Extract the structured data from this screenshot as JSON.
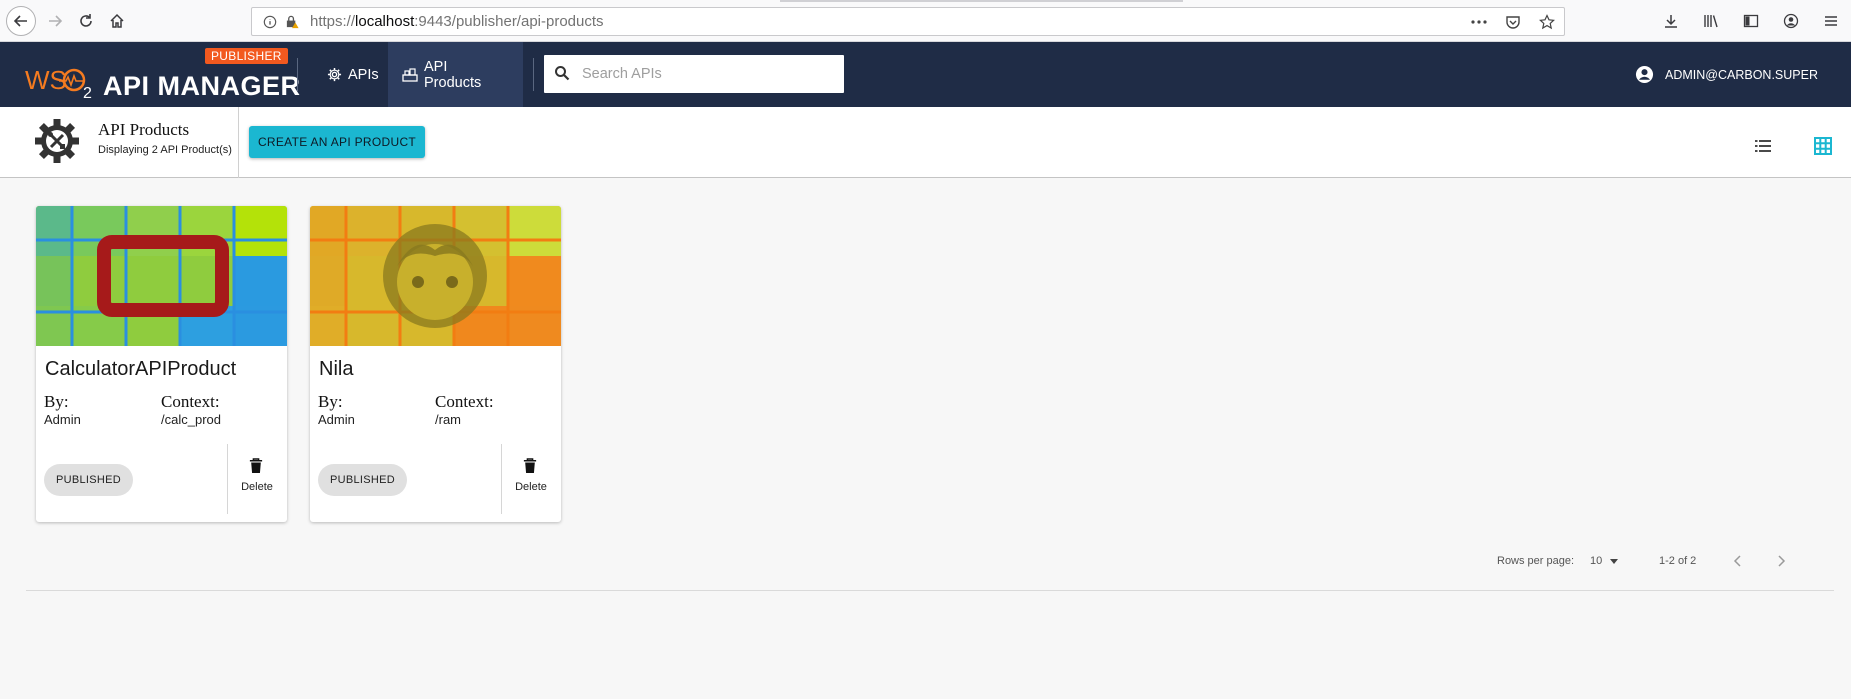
{
  "browser": {
    "url_protocol": "https://",
    "url_host": "localhost",
    "url_path": ":9443/publisher/api-products",
    "icons": [
      "back-arrow-icon",
      "forward-arrow-icon",
      "reload-icon",
      "home-icon",
      "info-icon",
      "lock-warning-icon",
      "more-icon",
      "pocket-icon",
      "star-icon",
      "download-icon",
      "library-icon",
      "sidebar-icon",
      "account-icon",
      "menu-icon"
    ]
  },
  "header": {
    "badge": "PUBLISHER",
    "logo_brand": "WSO2",
    "logo_title": "API MANAGER",
    "nav": [
      {
        "label": "APIs",
        "icon": "gear-icon"
      },
      {
        "label": "API Products",
        "icon": "api-product-icon"
      }
    ],
    "search_placeholder": "Search APIs",
    "user": "ADMIN@CARBON.SUPER",
    "colors": {
      "bar": "#1f2c46",
      "badge": "#f2591f",
      "accent": "#1bb7d1"
    }
  },
  "subheader": {
    "title": "API Products",
    "caption": "Displaying 2 API Product(s)",
    "create_label": "CREATE AN API PRODUCT"
  },
  "cards": [
    {
      "name": "CalculatorAPIProduct",
      "by_label": "By:",
      "by": "Admin",
      "context_label": "Context:",
      "context": "/calc_prod",
      "status": "PUBLISHED",
      "delete_label": "Delete"
    },
    {
      "name": "Nila",
      "by_label": "By:",
      "by": "Admin",
      "context_label": "Context:",
      "context": "/ram",
      "status": "PUBLISHED",
      "delete_label": "Delete"
    }
  ],
  "pagination": {
    "rows_label": "Rows per page:",
    "rows_value": "10",
    "range": "1-2 of 2"
  }
}
